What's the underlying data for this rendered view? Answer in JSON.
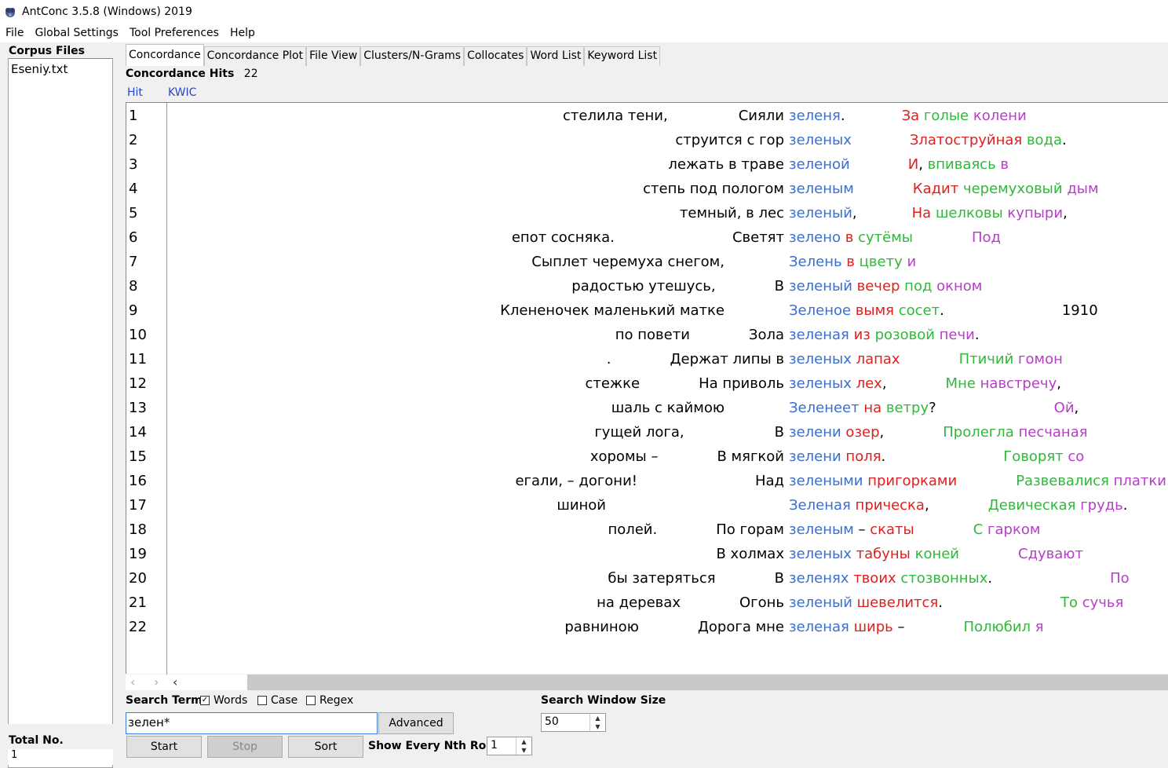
{
  "window": {
    "title": "AntConc 3.5.8 (Windows) 2019"
  },
  "menu": [
    "File",
    "Global Settings",
    "Tool Preferences",
    "Help"
  ],
  "corpus": {
    "label": "Corpus Files",
    "files": [
      "Eseniy.txt"
    ],
    "total_label": "Total No.",
    "total_value": "1"
  },
  "tabs": [
    "Concordance",
    "Concordance Plot",
    "File View",
    "Clusters/N-Grams",
    "Collocates",
    "Word List",
    "Keyword List"
  ],
  "hits": {
    "label": "Concordance Hits",
    "count": "22"
  },
  "columns": {
    "hit": "Hit",
    "kwic": "KWIC"
  },
  "rows": [
    {
      "n": "1",
      "left": [
        [
          "стелила тени,",
          90
        ],
        [
          "Сияли",
          0
        ]
      ],
      "kw": "зеленя",
      "right": [
        [
          ".",
          "k"
        ],
        [
          "gap",
          72
        ],
        [
          "За",
          "r"
        ],
        [
          " голые",
          "g"
        ],
        [
          " колени",
          "p"
        ]
      ]
    },
    {
      "n": "2",
      "left": [
        [
          "струится с гор",
          0
        ]
      ],
      "kw": "зеленых",
      "right": [
        [
          "gap",
          74
        ],
        [
          "Златоструйная",
          "r"
        ],
        [
          " вода",
          "g"
        ],
        [
          ".",
          "k"
        ]
      ]
    },
    {
      "n": "3",
      "left": [
        [
          "лежать в траве",
          0
        ]
      ],
      "kw": "зеленой",
      "right": [
        [
          "gap",
          74
        ],
        [
          "И",
          "r"
        ],
        [
          ",",
          "k"
        ],
        [
          " впиваясь",
          "g"
        ],
        [
          " в",
          "p"
        ]
      ]
    },
    {
      "n": "4",
      "left": [
        [
          "степь под пологом",
          0
        ]
      ],
      "kw": "зеленым",
      "right": [
        [
          "gap",
          75
        ],
        [
          "Кадит",
          "r"
        ],
        [
          " черемуховый",
          "g"
        ],
        [
          " дым",
          "p"
        ]
      ]
    },
    {
      "n": "5",
      "left": [
        [
          "темный, в лес",
          0
        ]
      ],
      "kw": "зеленый",
      "right": [
        [
          ",",
          "k"
        ],
        [
          "gap",
          70
        ],
        [
          "На",
          "r"
        ],
        [
          " шелковы",
          "g"
        ],
        [
          " купыри",
          "p"
        ],
        [
          ",",
          "k"
        ]
      ]
    },
    {
      "n": "6",
      "left": [
        [
          "епот сосняка.",
          150
        ],
        [
          "Светят",
          0
        ]
      ],
      "kw": "зелено",
      "right": [
        [
          " в",
          "r"
        ],
        [
          " сутёмы",
          "g"
        ],
        [
          "gap",
          75
        ],
        [
          "Под",
          "p"
        ]
      ]
    },
    {
      "n": "7",
      "left": [
        [
          "Сыплет черемуха снегом,",
          76
        ]
      ],
      "kw": "Зелень",
      "right": [
        [
          " в",
          "r"
        ],
        [
          " цвету",
          "g"
        ],
        [
          " и",
          "p"
        ]
      ]
    },
    {
      "n": "8",
      "left": [
        [
          "радостью утешусь,",
          75
        ],
        [
          "В",
          0
        ]
      ],
      "kw": "зеленый",
      "right": [
        [
          " вечер",
          "r"
        ],
        [
          " под",
          "g"
        ],
        [
          " окном",
          "p"
        ]
      ]
    },
    {
      "n": "9",
      "left": [
        [
          "Клененочек маленький матке",
          76
        ]
      ],
      "kw": "Зеленое",
      "right": [
        [
          " вымя",
          "r"
        ],
        [
          " сосет",
          "g"
        ],
        [
          ".",
          "k"
        ],
        [
          "gap",
          150
        ],
        [
          "1910",
          "k"
        ]
      ]
    },
    {
      "n": "10",
      "left": [
        [
          "по повети",
          75
        ],
        [
          "Зола",
          0
        ]
      ],
      "kw": "зеленая",
      "right": [
        [
          " из",
          "r"
        ],
        [
          " розовой",
          "g"
        ],
        [
          " печи",
          "p"
        ],
        [
          ".",
          "k"
        ]
      ]
    },
    {
      "n": "11",
      "left": [
        [
          ".",
          75
        ],
        [
          "Держат липы в",
          0
        ]
      ],
      "kw": "зеленых",
      "right": [
        [
          " лапах",
          "r"
        ],
        [
          "gap",
          75
        ],
        [
          "Птичий",
          "g"
        ],
        [
          " гомон",
          "p"
        ]
      ]
    },
    {
      "n": "12",
      "left": [
        [
          "стежке",
          75
        ],
        [
          "На приволь",
          0
        ]
      ],
      "kw": "зеленых",
      "right": [
        [
          " лех",
          "r"
        ],
        [
          ",",
          "k"
        ],
        [
          "gap",
          75
        ],
        [
          "Мне",
          "g"
        ],
        [
          " навстречу",
          "p"
        ],
        [
          ",",
          "k"
        ]
      ]
    },
    {
      "n": "13",
      "left": [
        [
          "шаль с каймою",
          76
        ]
      ],
      "kw": "Зеленеет",
      "right": [
        [
          " на",
          "r"
        ],
        [
          " ветру",
          "g"
        ],
        [
          "?",
          "k"
        ],
        [
          "gap",
          150
        ],
        [
          "Ой",
          "p"
        ],
        [
          ",",
          "k"
        ]
      ]
    },
    {
      "n": "14",
      "left": [
        [
          "гущей лога,",
          115
        ],
        [
          "В",
          0
        ]
      ],
      "kw": "зелени",
      "right": [
        [
          " озер",
          "r"
        ],
        [
          ",",
          "k"
        ],
        [
          "gap",
          75
        ],
        [
          "Пролегла",
          "g"
        ],
        [
          " песчаная",
          "p"
        ]
      ]
    },
    {
      "n": "15",
      "left": [
        [
          "хоромы –",
          75
        ],
        [
          "В мягкой",
          0
        ]
      ],
      "kw": "зелени",
      "right": [
        [
          " поля",
          "r"
        ],
        [
          ".",
          "k"
        ],
        [
          "gap",
          150
        ],
        [
          "Говорят",
          "g"
        ],
        [
          " со",
          "p"
        ]
      ]
    },
    {
      "n": "16",
      "left": [
        [
          "егали, – догони!",
          150
        ],
        [
          "Над",
          0
        ]
      ],
      "kw": "зелеными",
      "right": [
        [
          " пригорками",
          "r"
        ],
        [
          "gap",
          75
        ],
        [
          "Развевалися",
          "g"
        ],
        [
          " платки",
          "p"
        ],
        [
          ".",
          "k"
        ]
      ]
    },
    {
      "n": "17",
      "left": [
        [
          "шиной",
          227
        ]
      ],
      "kw": "Зеленая",
      "right": [
        [
          " прическа",
          "r"
        ],
        [
          ",",
          "k"
        ],
        [
          "gap",
          75
        ],
        [
          "Девическая",
          "g"
        ],
        [
          " грудь",
          "p"
        ],
        [
          ".",
          "k"
        ]
      ]
    },
    {
      "n": "18",
      "left": [
        [
          "полей.",
          75
        ],
        [
          "По горам",
          0
        ]
      ],
      "kw": "зеленым",
      "right": [
        [
          " –",
          "k"
        ],
        [
          " скаты",
          "r"
        ],
        [
          "gap",
          75
        ],
        [
          "С",
          "g"
        ],
        [
          " гарком",
          "p"
        ]
      ]
    },
    {
      "n": "19",
      "left": [
        [
          "В холмах",
          0
        ]
      ],
      "kw": "зеленых",
      "right": [
        [
          " табуны",
          "r"
        ],
        [
          " коней",
          "g"
        ],
        [
          "gap",
          75
        ],
        [
          "Сдувают",
          "p"
        ]
      ]
    },
    {
      "n": "20",
      "left": [
        [
          "бы затеряться",
          75
        ],
        [
          "В",
          0
        ]
      ],
      "kw": "зеленях",
      "right": [
        [
          " твоих",
          "r"
        ],
        [
          " стозвонных",
          "g"
        ],
        [
          ".",
          "k"
        ],
        [
          "gap",
          150
        ],
        [
          "По",
          "p"
        ]
      ]
    },
    {
      "n": "21",
      "left": [
        [
          "на деревах",
          75
        ],
        [
          "Огонь",
          0
        ]
      ],
      "kw": "зеленый",
      "right": [
        [
          " шевелится",
          "r"
        ],
        [
          ".",
          "k"
        ],
        [
          "gap",
          150
        ],
        [
          "То",
          "g"
        ],
        [
          " сучья",
          "p"
        ]
      ]
    },
    {
      "n": "22",
      "left": [
        [
          "равниною",
          75
        ],
        [
          "Дорога мне",
          0
        ]
      ],
      "kw": "зеленая",
      "right": [
        [
          " ширь",
          "r"
        ],
        [
          " –",
          "k"
        ],
        [
          "gap",
          75
        ],
        [
          "Полюбил",
          "g"
        ],
        [
          " я",
          "p"
        ]
      ]
    }
  ],
  "search": {
    "label": "Search Term",
    "words_label": "Words",
    "words_checked": true,
    "case_label": "Case",
    "case_checked": false,
    "regex_label": "Regex",
    "regex_checked": false,
    "term": "зелен*",
    "advanced": "Advanced",
    "start": "Start",
    "stop": "Stop",
    "sort": "Sort",
    "nth_label": "Show Every Nth Row",
    "nth_value": "1",
    "window_label": "Search Window Size",
    "window_value": "50"
  },
  "colors": {
    "keyword": "#3a6fd0",
    "r1": "#e0201e",
    "r2": "#2fb83a",
    "r3": "#b53fc6"
  }
}
